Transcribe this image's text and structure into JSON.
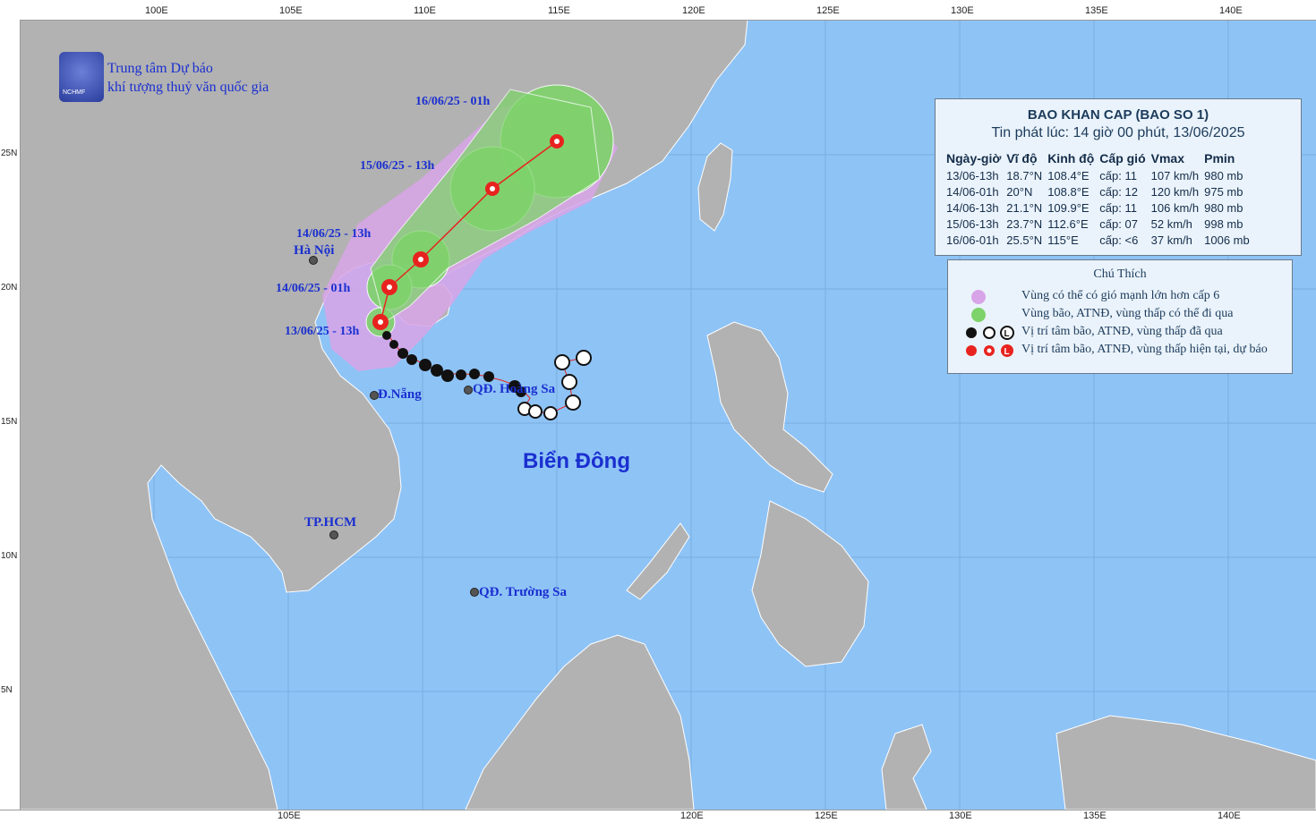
{
  "header": {
    "org_line1": "Trung tâm Dự báo",
    "org_line2": "khí tượng thuỷ văn quốc gia",
    "logo_text": "NCHMF"
  },
  "axes": {
    "lon_top": [
      "100E",
      "105E",
      "110E",
      "115E",
      "120E",
      "125E",
      "130E",
      "135E",
      "140E"
    ],
    "lon_bottom": [
      "105E",
      "120E",
      "125E",
      "130E",
      "135E",
      "140E"
    ],
    "lat": [
      "25N",
      "20N",
      "15N",
      "10N",
      "5N"
    ]
  },
  "places": {
    "hanoi": "Hà Nội",
    "danang": "Đ.Nẵng",
    "hcm": "TP.HCM",
    "hoangsa": "QĐ. Hoàng Sa",
    "truongsa": "QĐ. Trường Sa",
    "sea": "Biển Đông"
  },
  "track_labels": {
    "t1": "16/06/25 - 01h",
    "t2": "15/06/25 - 13h",
    "t3": "14/06/25 - 13h",
    "t4": "14/06/25 - 01h",
    "t5": "13/06/25 - 13h"
  },
  "bulletin": {
    "title": "BAO KHAN CAP (BAO SO 1)",
    "issued": "Tin phát lúc: 14 giờ 00 phút, 13/06/2025",
    "columns": [
      "Ngày-giờ",
      "Vĩ độ",
      "Kinh độ",
      "Cấp gió",
      "Vmax",
      "Pmin"
    ],
    "rows": [
      [
        "13/06-13h",
        "18.7°N",
        "108.4°E",
        "cấp: 11",
        "107 km/h",
        "980 mb"
      ],
      [
        "14/06-01h",
        "20°N",
        "108.8°E",
        "cấp: 12",
        "120 km/h",
        "975 mb"
      ],
      [
        "14/06-13h",
        "21.1°N",
        "109.9°E",
        "cấp: 11",
        "106 km/h",
        "980 mb"
      ],
      [
        "15/06-13h",
        "23.7°N",
        "112.6°E",
        "cấp: 07",
        "52 km/h",
        "998 mb"
      ],
      [
        "16/06-01h",
        "25.5°N",
        "115°E",
        "cấp: <6",
        "37 km/h",
        "1006 mb"
      ]
    ]
  },
  "legend": {
    "title": "Chú Thích",
    "items": [
      "Vùng có thể có gió mạnh lớn hơn cấp 6",
      "Vùng bão, ATNĐ, vùng thấp có thể đi qua",
      "Vị trí tâm bão, ATNĐ, vùng thấp đã qua",
      "Vị trí tâm bão, ATNĐ, vùng thấp hiện tại, dự báo"
    ],
    "symbol_L": "L",
    "colors": {
      "strong_wind": "#d8a4e8",
      "storm_zone": "#7ed36b",
      "past": "#111111",
      "current": "#e8231f"
    }
  },
  "colors": {
    "sea": "#8ec3f6",
    "land": "#b2b2b2",
    "label_blue": "#1a2fd0"
  }
}
